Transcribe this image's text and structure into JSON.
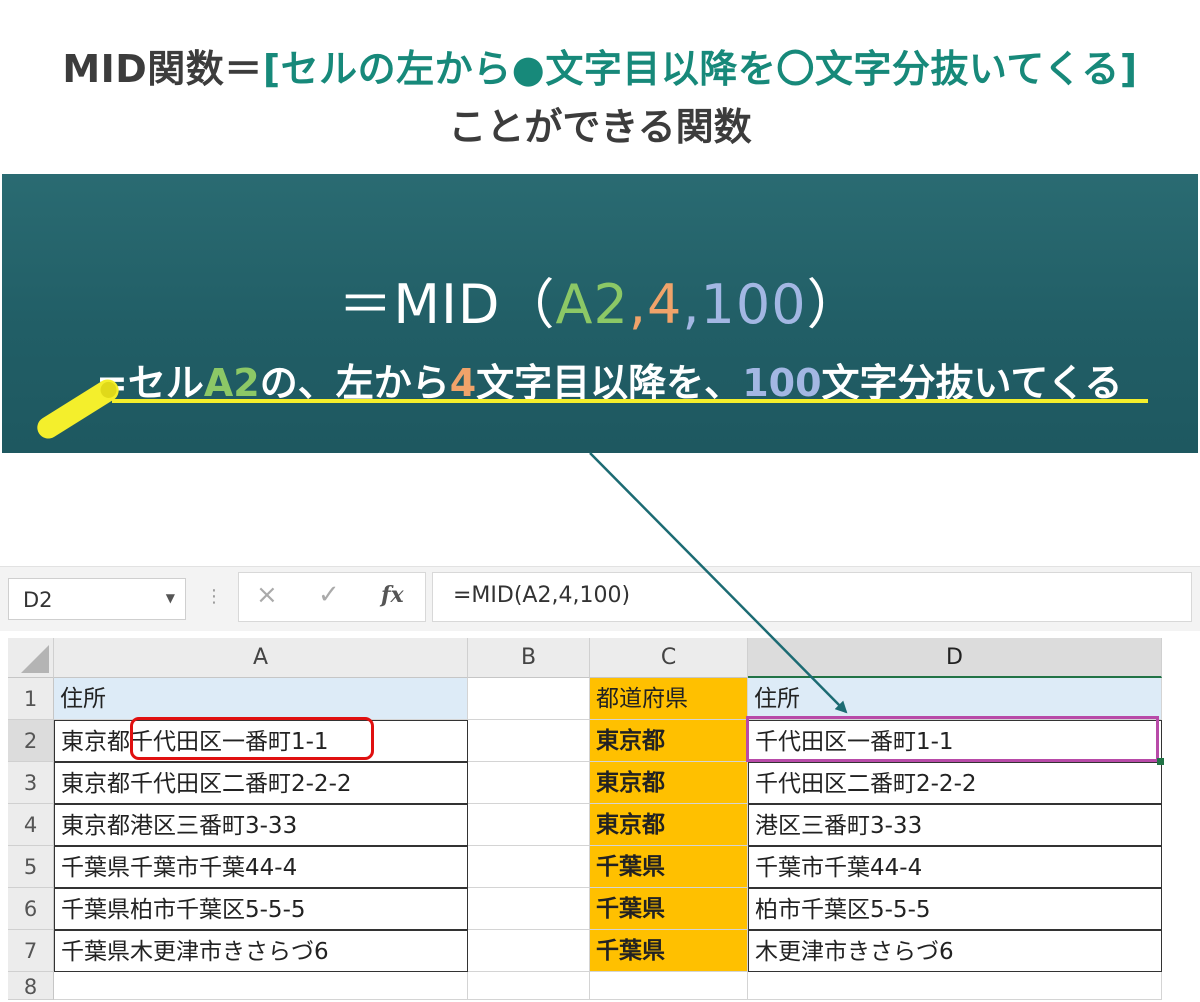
{
  "heading": {
    "prefix": "MID関数＝",
    "accent": "[セルの左から●文字目以降を〇文字分抜いてくる]",
    "line2": "ことができる関数"
  },
  "chalkboard": {
    "formula": {
      "eq": "＝MID（",
      "arg1": "A2",
      "sep1": ",",
      "arg2": "4",
      "sep2": ",",
      "arg3": "100",
      "close": "）"
    },
    "explanation": {
      "p1": "=セル",
      "a2": "A2",
      "p2": "の、左から",
      "n4": "4",
      "p3": "文字目以降を、",
      "n100": "100",
      "p4": "文字分抜いてくる"
    },
    "colors": {
      "board": "#215e66",
      "arg1": "#8cc866",
      "arg2": "#f0a36a",
      "arg3": "#a3b7e3",
      "chalk": "#f4ef2c"
    }
  },
  "spreadsheet": {
    "name_box": "D2",
    "formula_bar": "=MID(A2,4,100)",
    "icons": {
      "cancel": "×",
      "enter": "✓",
      "fx": "fx",
      "namebox_dropdown": "▼",
      "dots": "⋮"
    },
    "columns": [
      "A",
      "B",
      "C",
      "D"
    ],
    "selected_column": "D",
    "row_numbers": [
      "1",
      "2",
      "3",
      "4",
      "5",
      "6",
      "7",
      "8"
    ],
    "header_row": {
      "A": "住所",
      "C": "都道府県",
      "D": "住所"
    },
    "rows": [
      {
        "A": "東京都千代田区一番町1-1",
        "C": "東京都",
        "D": "千代田区一番町1-1"
      },
      {
        "A": "東京都千代田区二番町2-2-2",
        "C": "東京都",
        "D": "千代田区二番町2-2-2"
      },
      {
        "A": "東京都港区三番町3-33",
        "C": "東京都",
        "D": "港区三番町3-33"
      },
      {
        "A": "千葉県千葉市千葉44-4",
        "C": "千葉県",
        "D": "千葉市千葉44-4"
      },
      {
        "A": "千葉県柏市千葉区5-5-5",
        "C": "千葉県",
        "D": "柏市千葉区5-5-5"
      },
      {
        "A": "千葉県木更津市きさらづ6",
        "C": "千葉県",
        "D": "木更津市きさらづ6"
      }
    ],
    "colors": {
      "header_fill": "#ddebf7",
      "prefecture_fill": "#ffc000",
      "highlight_red": "#e01010",
      "highlight_purple": "#b84aa8",
      "arrow": "#1c6b73"
    }
  }
}
